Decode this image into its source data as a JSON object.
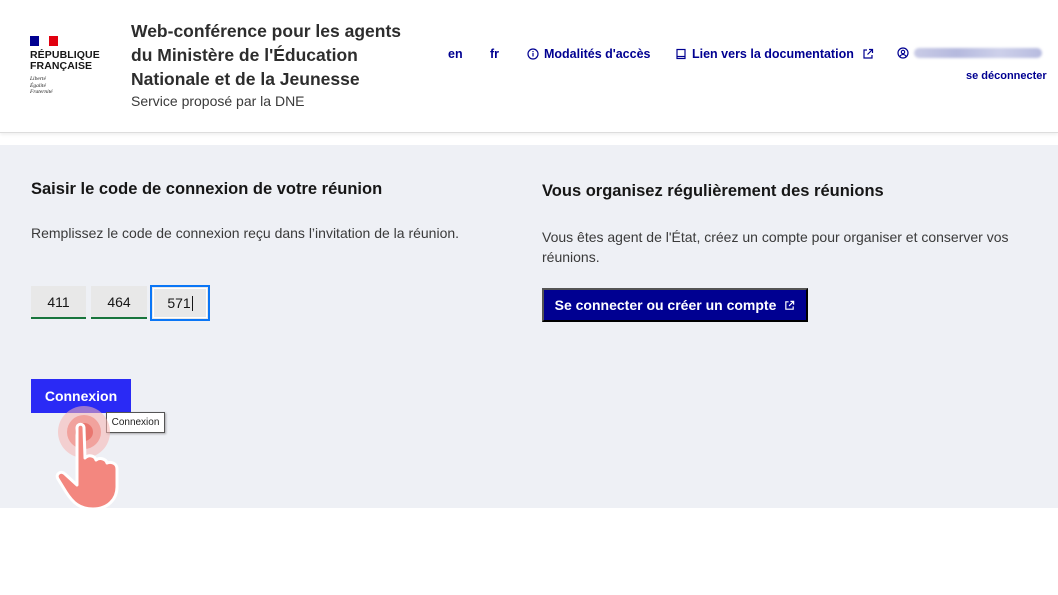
{
  "header": {
    "logo": {
      "line1": "RÉPUBLIQUE",
      "line2": "FRANÇAISE",
      "motto": [
        "Liberté",
        "Égalité",
        "Fraternité"
      ]
    },
    "service_title": "Web-conférence pour les agents du Ministère de l'Éducation Nationale et de la Jeunesse",
    "service_tagline": "Service proposé par la DNE",
    "nav": {
      "lang_en": "en",
      "lang_fr": "fr",
      "access": "Modalités d'accès",
      "docs": "Lien vers la documentation",
      "logout": "se déconnecter"
    },
    "icons": {
      "access": "info-circle-icon",
      "docs": "book-icon",
      "external": "external-link-icon",
      "user": "user-circle-icon"
    }
  },
  "join": {
    "heading": "Saisir le code de connexion de votre réunion",
    "description": "Remplissez le code de connexion reçu dans l’invitation de la réunion.",
    "code": [
      "411",
      "464",
      "571"
    ],
    "button": "Connexion",
    "tooltip": "Connexion"
  },
  "organize": {
    "heading": "Vous organisez régulièrement des réunions",
    "description": "Vous êtes agent de l'État, créez un compte pour organiser et conserver vos réunions.",
    "button": "Se connecter ou créer un compte"
  },
  "colors": {
    "primary": "#000091",
    "connect_button": "#2a2af5",
    "success_border": "#18753c",
    "focus": "#0a76f6",
    "band": "#eef0f5"
  }
}
